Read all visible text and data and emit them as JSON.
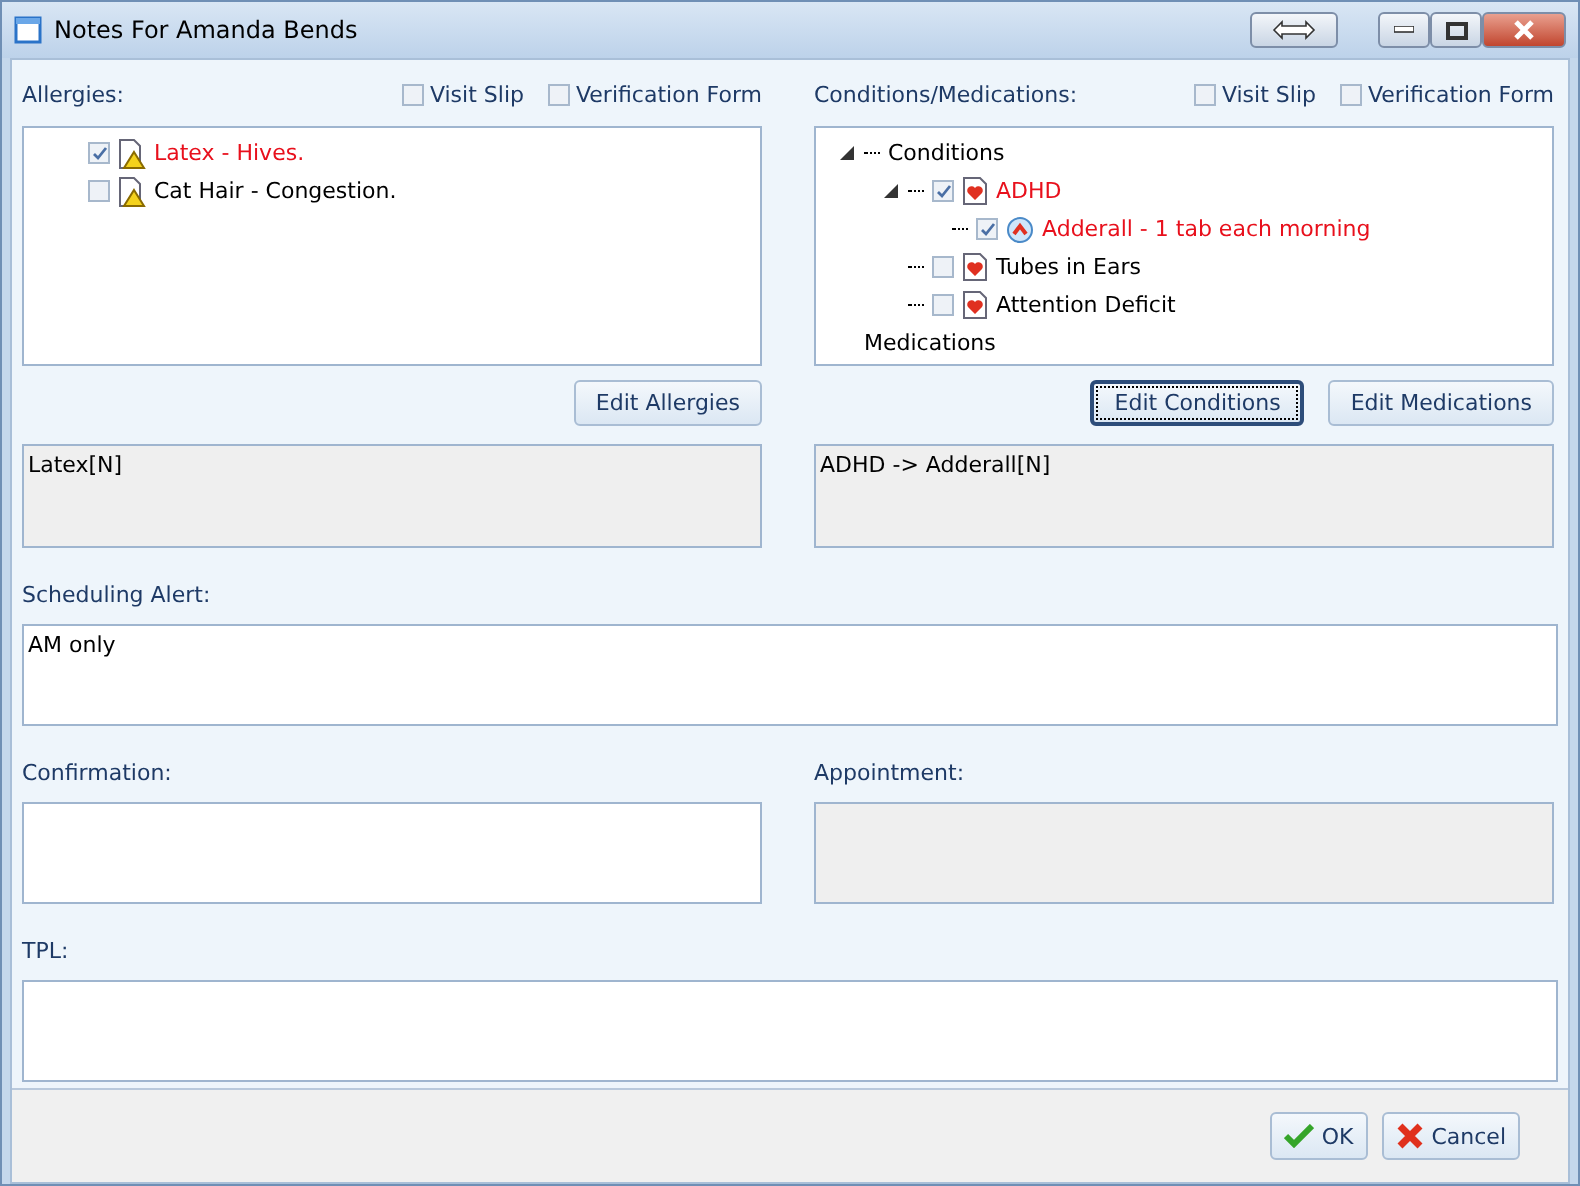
{
  "window": {
    "title": "Notes For Amanda Bends"
  },
  "allergies": {
    "label": "Allergies:",
    "options": [
      {
        "label": "Visit Slip",
        "checked": false
      },
      {
        "label": "Verification Form",
        "checked": false
      }
    ],
    "items": [
      {
        "label": "Latex - Hives.",
        "checked": true,
        "flagged": true
      },
      {
        "label": "Cat Hair - Congestion.",
        "checked": false,
        "flagged": false
      }
    ],
    "buttons": [
      {
        "label": "Edit Allergies",
        "focused": false
      }
    ],
    "summary": {
      "value": "Latex[N]",
      "disabled": true
    }
  },
  "conditions": {
    "label": "Conditions/Medications:",
    "options": [
      {
        "label": "Visit Slip",
        "checked": false
      },
      {
        "label": "Verification Form",
        "checked": false
      }
    ],
    "tree": [
      {
        "label": "Conditions",
        "kind": "group",
        "expanded": true,
        "children": [
          {
            "label": "ADHD",
            "kind": "condition",
            "checked": true,
            "flagged": true,
            "expanded": true,
            "children": [
              {
                "label": "Adderall - 1 tab each morning",
                "kind": "medication",
                "checked": true,
                "flagged": true
              }
            ]
          },
          {
            "label": "Tubes in Ears",
            "kind": "condition",
            "checked": false,
            "flagged": false
          },
          {
            "label": "Attention Deficit",
            "kind": "condition",
            "checked": false,
            "flagged": false
          }
        ]
      },
      {
        "label": "Medications",
        "kind": "group"
      }
    ],
    "buttons": [
      {
        "label": "Edit Conditions",
        "focused": true
      },
      {
        "label": "Edit Medications",
        "focused": false
      }
    ],
    "summary": {
      "value": "ADHD -> Adderall[N]",
      "disabled": true
    }
  },
  "scheduling_alert": {
    "label": "Scheduling Alert:",
    "value": "AM only",
    "disabled": false
  },
  "confirmation": {
    "label": "Confirmation:",
    "disabled": false
  },
  "appointment": {
    "label": "Appointment:",
    "disabled": true
  },
  "tpl": {
    "label": "TPL:",
    "disabled": false
  },
  "footer": {
    "buttons": [
      {
        "label": "OK",
        "kind": "ok"
      },
      {
        "label": "Cancel",
        "kind": "cancel"
      }
    ]
  }
}
